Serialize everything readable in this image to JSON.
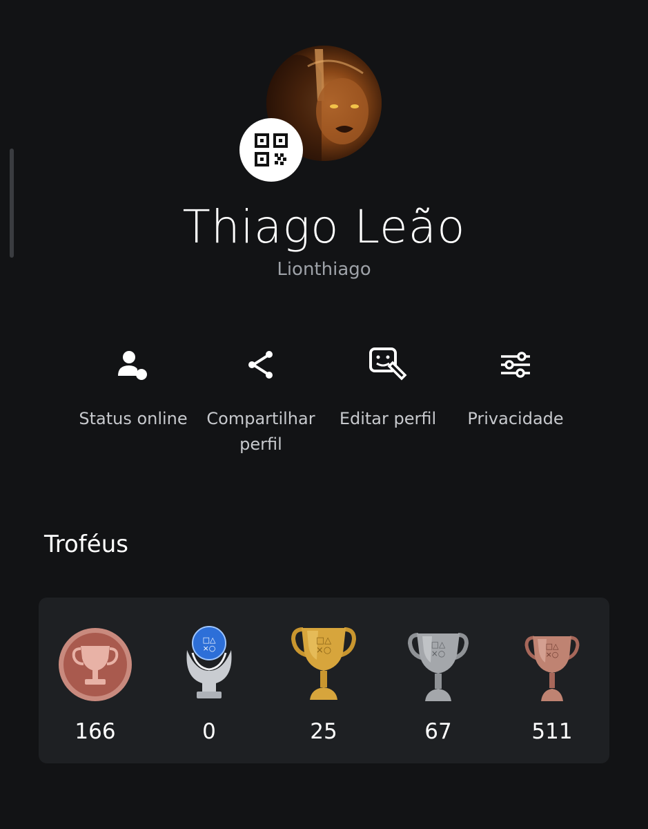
{
  "profile": {
    "display_name": "Thiago Leão",
    "username": "Lionthiago",
    "avatar_icon": "lion-avatar",
    "qr_icon": "qr-code-icon"
  },
  "actions": [
    {
      "label": "Status online",
      "icon": "user-status-icon"
    },
    {
      "label": "Compartilhar perfil",
      "icon": "share-icon"
    },
    {
      "label": "Editar perfil",
      "icon": "edit-profile-icon"
    },
    {
      "label": "Privacidade",
      "icon": "sliders-icon"
    }
  ],
  "trophies": {
    "title": "Troféus",
    "items": [
      {
        "type": "level",
        "count": "166",
        "color": "#b9675c"
      },
      {
        "type": "platinum",
        "count": "0",
        "color": "#3b7fd9"
      },
      {
        "type": "gold",
        "count": "25",
        "color": "#c9962f"
      },
      {
        "type": "silver",
        "count": "67",
        "color": "#9a9ca0"
      },
      {
        "type": "bronze",
        "count": "511",
        "color": "#b87865"
      }
    ]
  },
  "colors": {
    "background": "#121315",
    "card": "#1e2023",
    "muted_text": "#9ea2a8"
  }
}
